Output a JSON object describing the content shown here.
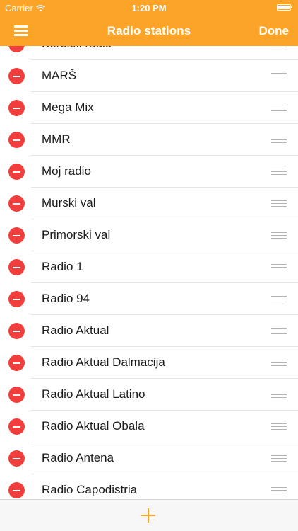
{
  "status_bar": {
    "carrier": "Carrier",
    "time": "1:20 PM"
  },
  "nav_bar": {
    "title": "Radio stations",
    "done_label": "Done",
    "menu_icon": "hamburger-menu-icon"
  },
  "stations": [
    "Koroški radio",
    "MARŠ",
    "Mega Mix",
    "MMR",
    "Moj radio",
    "Murski val",
    "Primorski val",
    "Radio 1",
    "Radio 94",
    "Radio Aktual",
    "Radio Aktual Dalmacija",
    "Radio Aktual Latino",
    "Radio Aktual Obala",
    "Radio Antena",
    "Radio Capodistria"
  ],
  "toolbar": {
    "add_icon": "plus-icon"
  },
  "colors": {
    "accent": "#fba428",
    "delete": "#f23d3d",
    "separator": "#e5e5e5"
  }
}
